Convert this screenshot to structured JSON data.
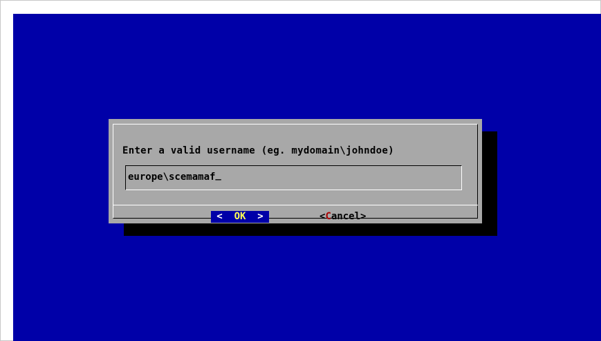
{
  "colors": {
    "console_background": "#0000a8",
    "dialog_background": "#a8a8a8",
    "shadow": "#000000",
    "selected_button_background": "#0000a8",
    "hotkey_selected": "#ffff55",
    "hotkey_unselected": "#a80000"
  },
  "dialog": {
    "prompt": "Enter a valid username (eg. mydomain\\johndoe)",
    "input": {
      "value": "europe\\scemamaf",
      "cursor": "_"
    },
    "buttons": {
      "ok": {
        "left_bracket": "<",
        "hotkey": "OK",
        "right_bracket": ">",
        "selected": true
      },
      "cancel": {
        "left_bracket": "<",
        "hotkey": "C",
        "rest": "ancel",
        "right_bracket": ">",
        "selected": false
      }
    }
  }
}
